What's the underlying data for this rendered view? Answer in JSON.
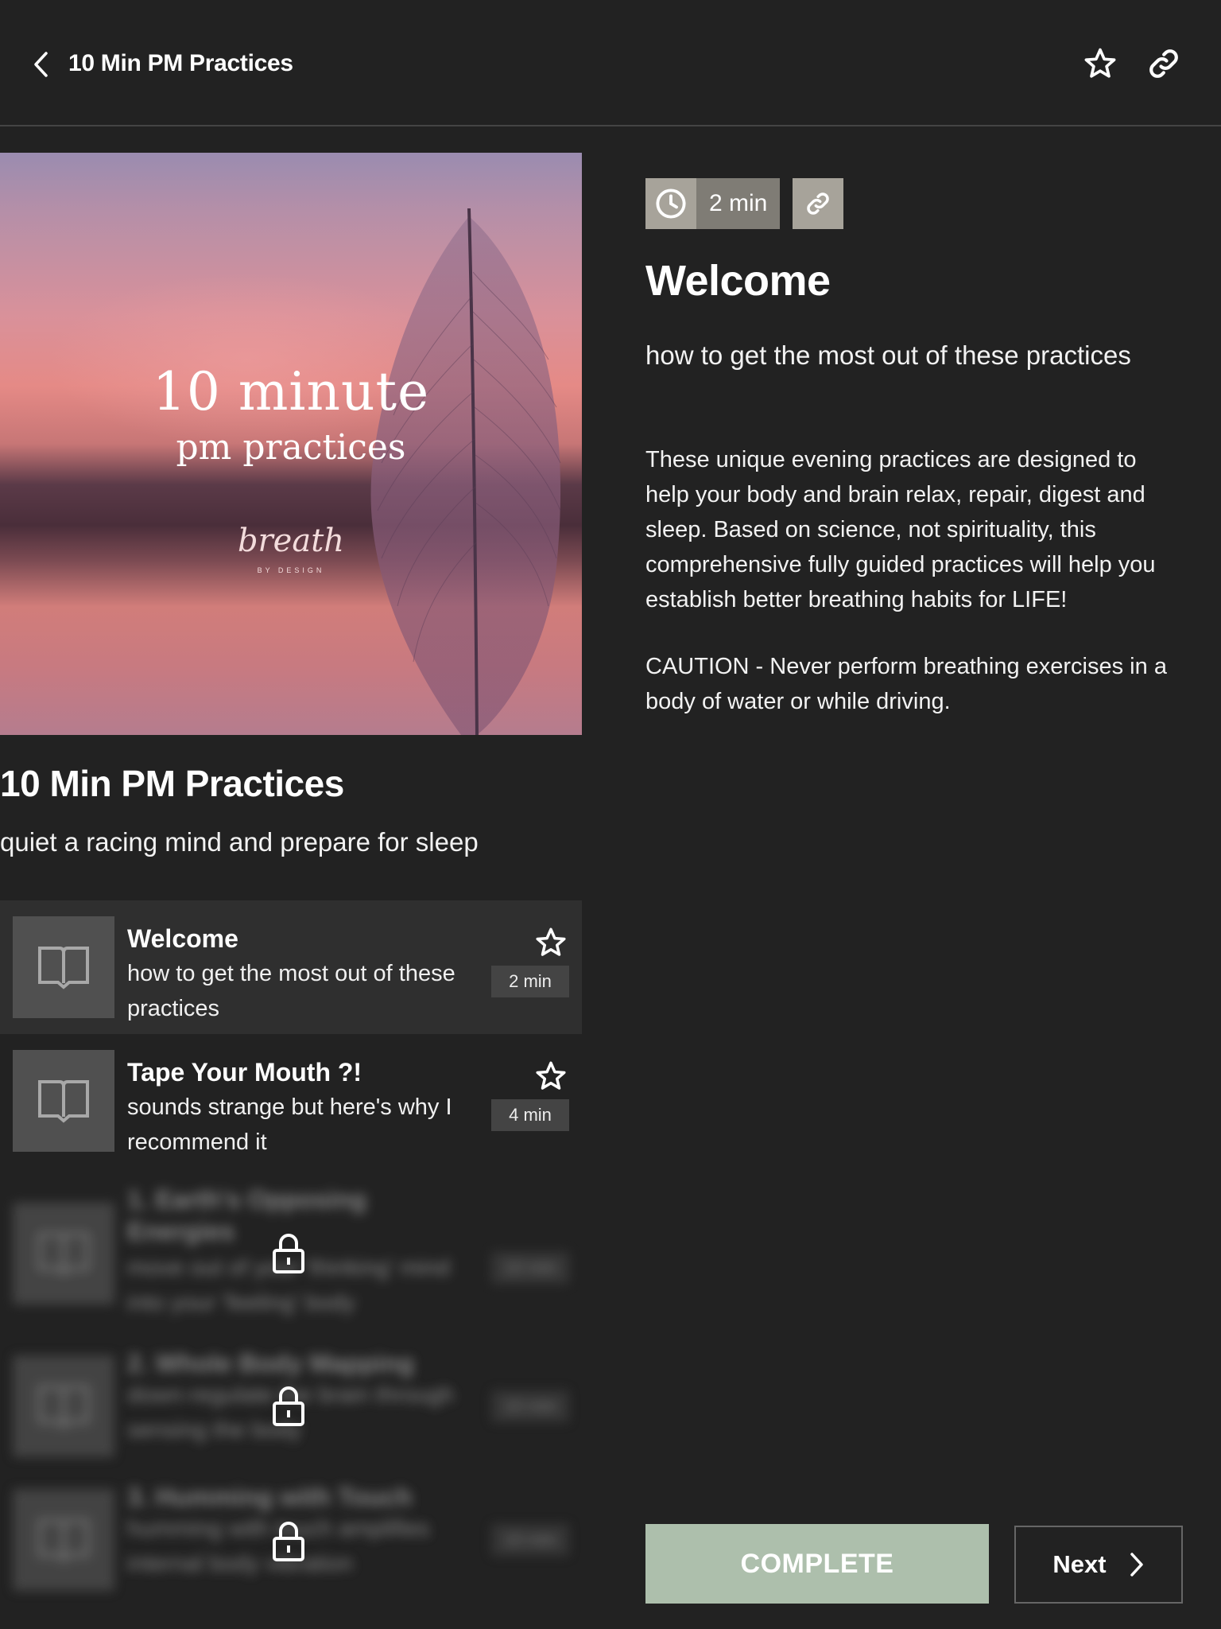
{
  "header": {
    "title": "10 Min PM Practices",
    "back_icon": "chevron-left-icon",
    "favorite_icon": "star-outline-icon",
    "share_icon": "link-icon"
  },
  "cover": {
    "title_line1": "10 minute",
    "title_line2": "pm practices",
    "logo_text": "breath",
    "logo_subtext": "BY DESIGN"
  },
  "course": {
    "title": "10 Min PM Practices",
    "subtitle": "quiet a racing mind and prepare for sleep"
  },
  "lessons": [
    {
      "title": "Welcome",
      "subtitle": "how to get the most out of these practices",
      "duration": "2 min",
      "locked": false,
      "active": true
    },
    {
      "title": "Tape Your Mouth ?!",
      "subtitle": "sounds strange but here's why I recommend it",
      "duration": "4 min",
      "locked": false,
      "active": false
    },
    {
      "title": "1. Earth's Opposing Energies",
      "subtitle": "move out of your 'thinking' mind into your 'feeling' body",
      "duration": "10 min",
      "locked": true
    },
    {
      "title": "2. Whole Body Mapping",
      "subtitle": "down-regulate the brain through sensing the body",
      "duration": "10 min",
      "locked": true
    },
    {
      "title": "3. Humming with Touch",
      "subtitle": "humming with touch amplifies internal body vibration",
      "duration": "10 min",
      "locked": true
    }
  ],
  "detail": {
    "duration": "2 min",
    "title": "Welcome",
    "subtitle": "how to get the most out of these practices",
    "body": [
      "These unique evening practices are designed to help your body and brain relax, repair, digest and sleep. Based on science, not spirituality, this comprehensive fully guided practices will help you establish better breathing habits for LIFE!",
      "CAUTION - Never perform breathing exercises in a body of water or while driving."
    ]
  },
  "actions": {
    "complete_label": "COMPLETE",
    "next_label": "Next"
  },
  "colors": {
    "background": "#222222",
    "complete_button": "#adbfac",
    "duration_badge": "#7f7c75",
    "icon_badge": "#a7a39a"
  }
}
